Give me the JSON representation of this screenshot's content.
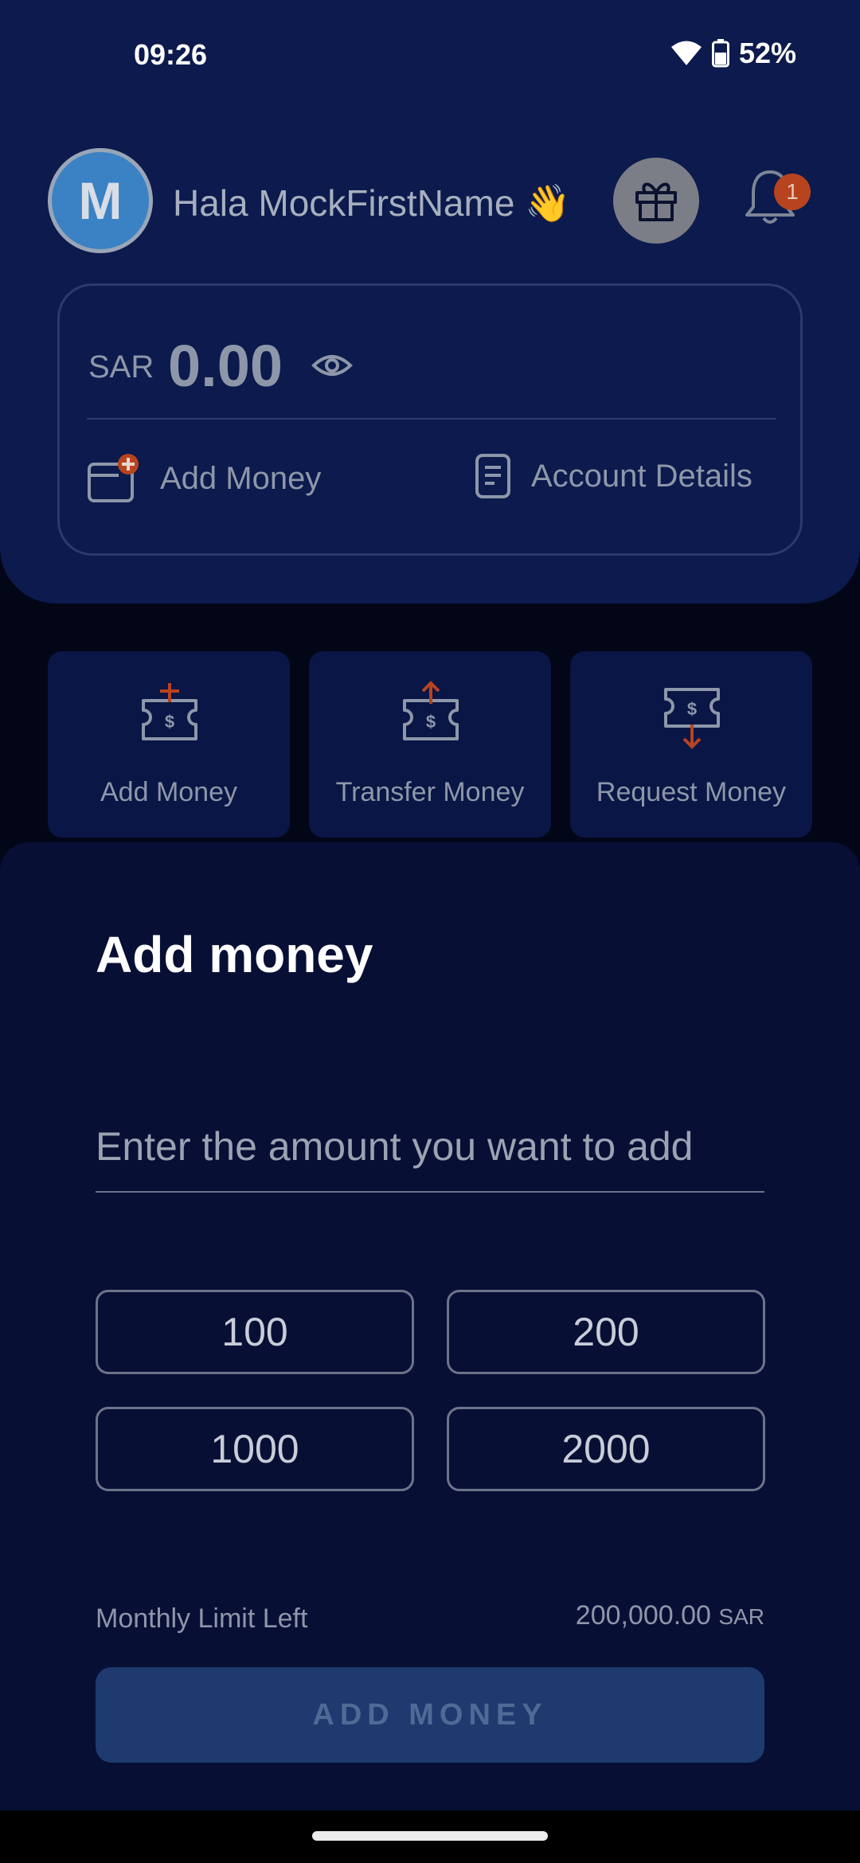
{
  "status": {
    "time": "09:26",
    "battery": "52%"
  },
  "header": {
    "avatar_initial": "M",
    "greeting": "Hala MockFirstName",
    "greeting_emoji": "👋",
    "notification_count": "1"
  },
  "balance": {
    "currency": "SAR",
    "amount": "0.00",
    "add_money_label": "Add Money",
    "account_details_label": "Account Details"
  },
  "quick_actions": [
    {
      "label": "Add Money"
    },
    {
      "label": "Transfer Money"
    },
    {
      "label": "Request Money"
    }
  ],
  "sheet": {
    "title": "Add money",
    "amount_placeholder": "Enter the amount you want to add",
    "amount_value": "",
    "presets": [
      "100",
      "200",
      "1000",
      "2000"
    ],
    "limit_label": "Monthly Limit Left",
    "limit_value": "200,000.00",
    "limit_unit": "SAR",
    "submit_label": "ADD MONEY"
  },
  "colors": {
    "header_bg": "#0c1a4d",
    "sheet_bg": "#070f35",
    "accent_red": "#b8431f",
    "button_bg": "#1e3a6f"
  }
}
